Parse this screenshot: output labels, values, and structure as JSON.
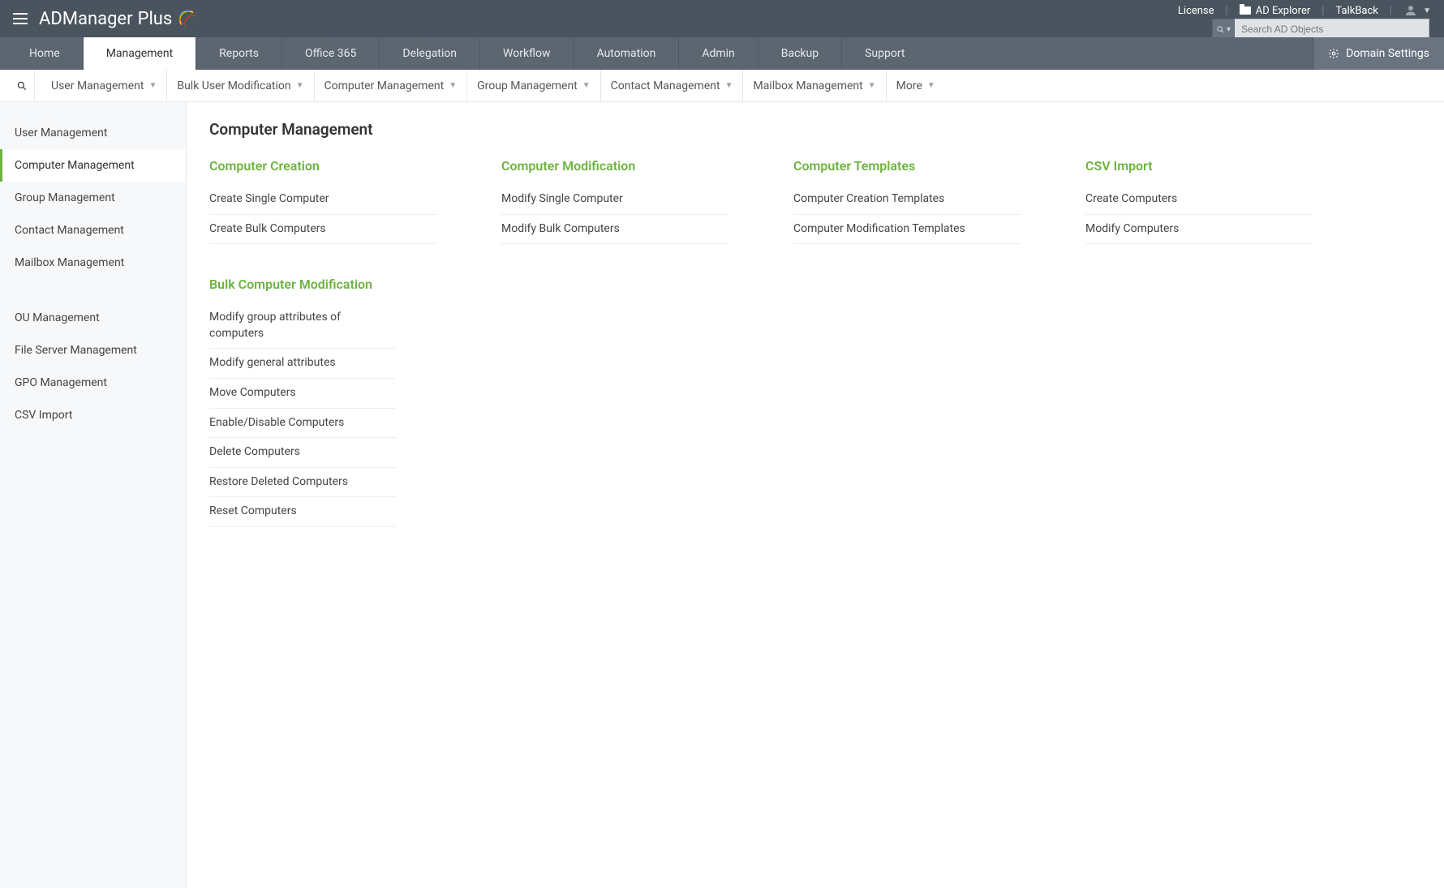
{
  "colors": {
    "header": "#4a545e",
    "nav": "#5c6670",
    "accent": "#6db33f"
  },
  "top": {
    "brand_main": "ADManager",
    "brand_suffix": "Plus",
    "license": "License",
    "ad_explorer": "AD Explorer",
    "talkback": "TalkBack"
  },
  "search": {
    "placeholder": "Search AD Objects"
  },
  "nav": {
    "tabs": [
      "Home",
      "Management",
      "Reports",
      "Office 365",
      "Delegation",
      "Workflow",
      "Automation",
      "Admin",
      "Backup",
      "Support"
    ],
    "active_index": 1,
    "domain_settings": "Domain Settings"
  },
  "subnav": {
    "items": [
      "User Management",
      "Bulk User Modification",
      "Computer Management",
      "Group Management",
      "Contact Management",
      "Mailbox Management",
      "More"
    ]
  },
  "sidebar": {
    "group1": [
      "User Management",
      "Computer Management",
      "Group Management",
      "Contact Management",
      "Mailbox Management"
    ],
    "active_index_g1": 1,
    "group2": [
      "OU Management",
      "File Server Management",
      "GPO Management",
      "CSV Import"
    ]
  },
  "page": {
    "title": "Computer Management",
    "sections_row1": [
      {
        "heading": "Computer Creation",
        "links": [
          "Create Single Computer",
          "Create Bulk Computers"
        ]
      },
      {
        "heading": "Computer Modification",
        "links": [
          "Modify Single Computer",
          "Modify Bulk Computers"
        ]
      },
      {
        "heading": "Computer Templates",
        "links": [
          "Computer Creation Templates",
          "Computer Modification Templates"
        ]
      },
      {
        "heading": "CSV Import",
        "links": [
          "Create Computers",
          "Modify Computers"
        ]
      }
    ],
    "sections_row2": [
      {
        "heading": "Bulk Computer Modification",
        "links": [
          "Modify group attributes of computers",
          "Modify general attributes",
          "Move Computers",
          "Enable/Disable Computers",
          "Delete Computers",
          "Restore Deleted Computers",
          "Reset Computers"
        ]
      }
    ]
  }
}
